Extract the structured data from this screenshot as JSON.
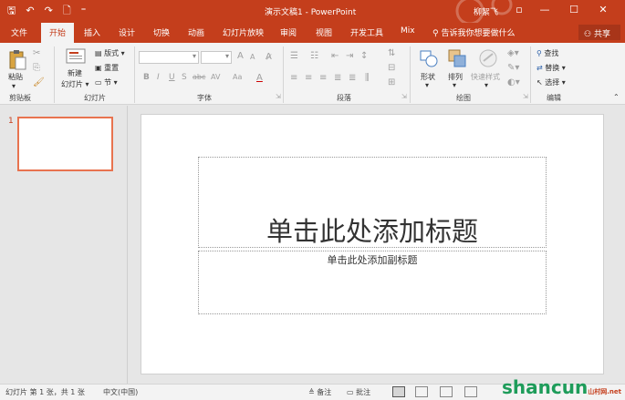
{
  "window": {
    "title": "演示文稿1  -  PowerPoint",
    "user": "柳絮飞",
    "controls": [
      "▫",
      "—",
      "☐",
      "✕"
    ]
  },
  "qat": {
    "save": "🖫",
    "undo": "↶",
    "redo": "↷",
    "new": "🗋",
    "more": "⁼"
  },
  "tabs": [
    "文件",
    "开始",
    "插入",
    "设计",
    "切换",
    "动画",
    "幻灯片放映",
    "审阅",
    "视图",
    "开发工具",
    "Mix"
  ],
  "active_tab": "开始",
  "tell_me": "告诉我你想要做什么",
  "share": "共享",
  "ribbon": {
    "clipboard": {
      "paste": "粘贴",
      "label": "剪贴板"
    },
    "slides": {
      "new_slide_1": "新建",
      "new_slide_2": "幻灯片",
      "layout": "版式",
      "reset": "重置",
      "section": "节",
      "label": "幻灯片"
    },
    "font": {
      "bold": "B",
      "italic": "I",
      "underline": "U",
      "strike": "S",
      "shadow": "abc",
      "spacing": "AV",
      "case": "Aa",
      "grow": "A",
      "shrink": "A",
      "color": "A",
      "label": "字体"
    },
    "paragraph": {
      "label": "段落"
    },
    "drawing": {
      "shapes": "形状",
      "arrange": "排列",
      "quick_styles": "快速样式",
      "label": "绘图"
    },
    "editing": {
      "find": "查找",
      "replace": "替换",
      "select": "选择",
      "label": "编辑"
    }
  },
  "slide_pane": {
    "number": "1"
  },
  "slide": {
    "title_placeholder": "单击此处添加标题",
    "subtitle_placeholder": "单击此处添加副标题"
  },
  "status": {
    "slide_info": "幻灯片 第 1 张，共 1 张",
    "language": "中文(中国)",
    "notes": "备注",
    "comments": "批注"
  },
  "watermark": {
    "brand": "shancun",
    "sub": "山村网",
    "net": ".net"
  },
  "colors": {
    "accent": "#c43e1c",
    "thumb_border": "#e8734f"
  }
}
